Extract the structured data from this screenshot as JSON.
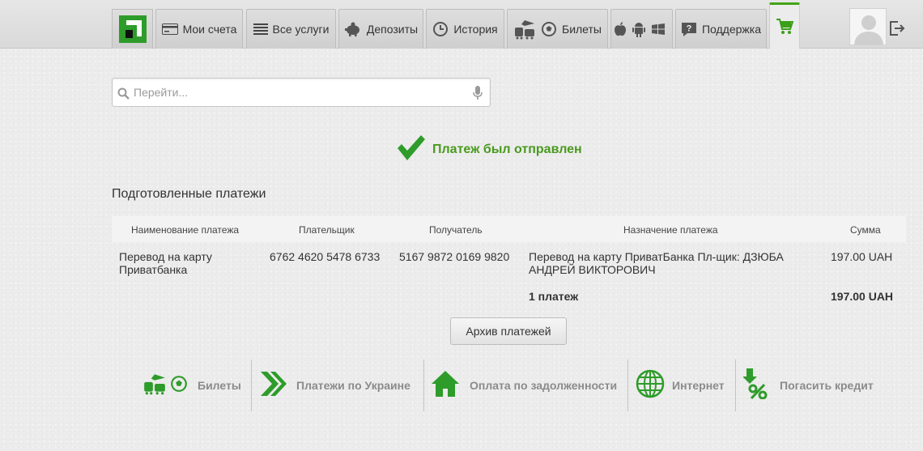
{
  "nav": {
    "accounts": "Мои счета",
    "services": "Все услуги",
    "deposits": "Депозиты",
    "history": "История",
    "tickets": "Билеты",
    "support": "Поддержка"
  },
  "search": {
    "placeholder": "Перейти..."
  },
  "status": {
    "message": "Платеж был отправлен"
  },
  "section_title": "Подготовленные платежи",
  "table": {
    "headers": [
      "Наименование платежа",
      "Плательщик",
      "Получатель",
      "Назначение платежа",
      "Сумма"
    ],
    "rows": [
      {
        "name_line1": "Перевод на карту",
        "name_line2": "Приватбанка",
        "payer": "6762 4620 5478 6733",
        "recipient": "5167 9872 0169 9820",
        "purpose_line1": "Перевод на карту ПриватБанка Пл-щик: ДЗЮБА",
        "purpose_line2": "АНДРЕЙ ВИКТОРОВИЧ",
        "amount": "197.00 UAH"
      }
    ],
    "total_count": "1  платеж",
    "total_amount": "197.00 UAH"
  },
  "archive_button": "Архив платежей",
  "quick_links": {
    "tickets": "Билеты",
    "ukraine": "Платежи по Украине",
    "debt": "Оплата по задолженности",
    "internet": "Интернет",
    "credit": "Погасить кредит"
  },
  "colors": {
    "accent": "#43a416",
    "success_text": "#4a9a1f",
    "link_gray": "#8b8b8b"
  }
}
